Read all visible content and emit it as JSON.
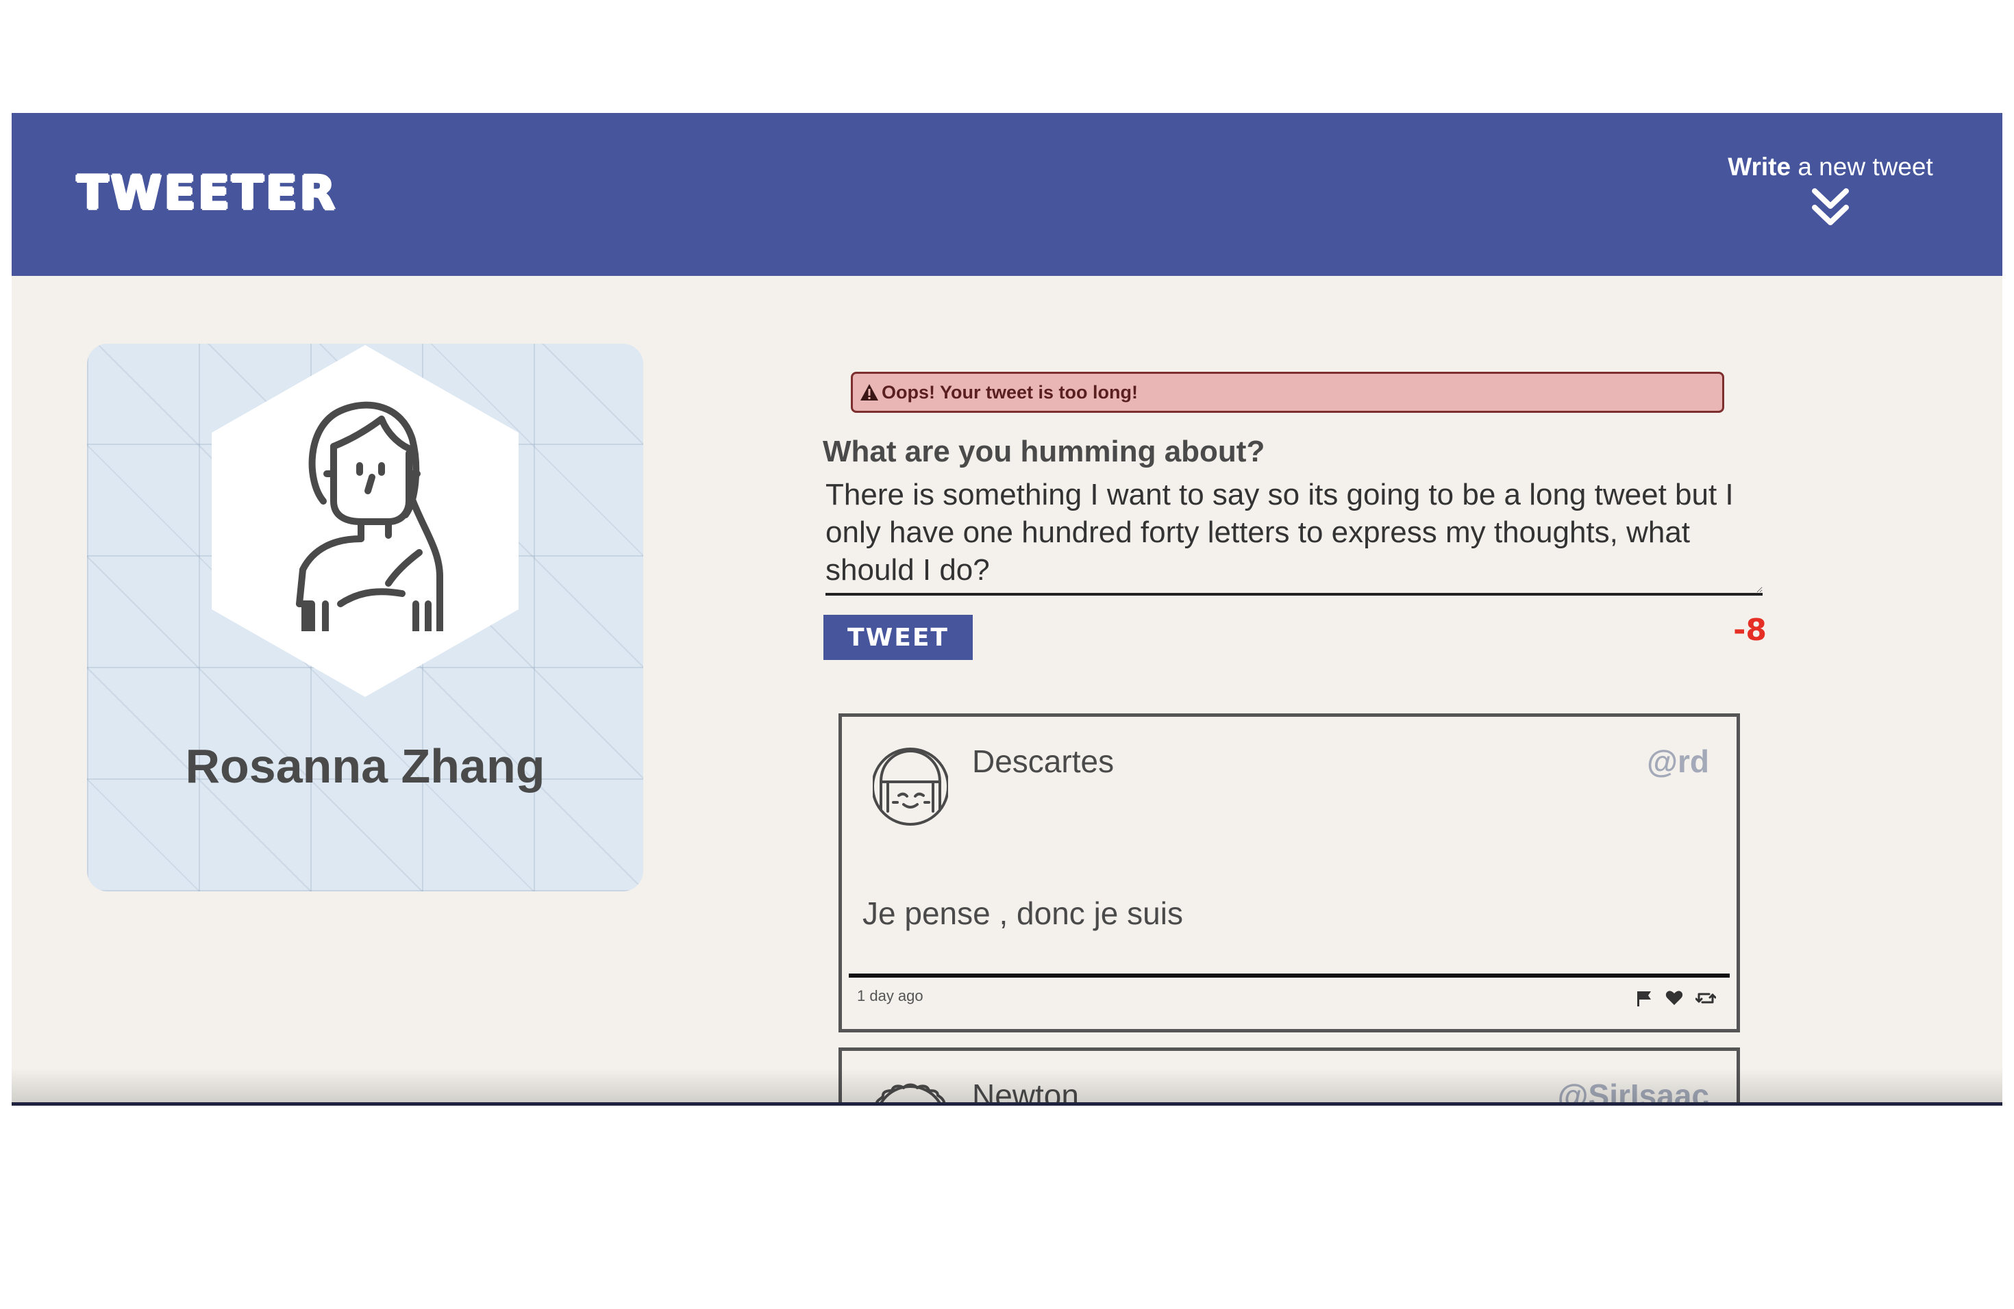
{
  "nav": {
    "brand": "TWEETER",
    "compose_toggle_bold": "Write",
    "compose_toggle_rest": " a new tweet",
    "compose_toggle_icon": "double-chevron-down-icon"
  },
  "profile": {
    "name": "Rosanna Zhang",
    "avatar_icon": "woman-avatar-icon"
  },
  "compose": {
    "error": "Oops! Your tweet is too long!",
    "error_icon": "warning-icon",
    "prompt": "What are you humming about?",
    "text": "There is something I want to say so its going to be a long tweet but I only have one hundred forty letters to express my thoughts, what should I do?",
    "button_label": "TWEET",
    "counter": "-8"
  },
  "tweets": [
    {
      "author": "Descartes",
      "handle": "@rd",
      "content": "Je pense , donc je suis",
      "time": "1 day ago",
      "avatar_icon": "girl-avatar-icon",
      "actions": [
        "flag-icon",
        "heart-icon",
        "retweet-icon"
      ]
    },
    {
      "author": "Newton",
      "handle": "@SirIsaac",
      "avatar_icon": "curly-hair-avatar-icon"
    }
  ],
  "colors": {
    "header": "#47569c",
    "background": "#f4f1ec",
    "error_bg": "#e9b6b5",
    "counter_negative": "#e52f24",
    "handle": "#a3a9b8"
  }
}
